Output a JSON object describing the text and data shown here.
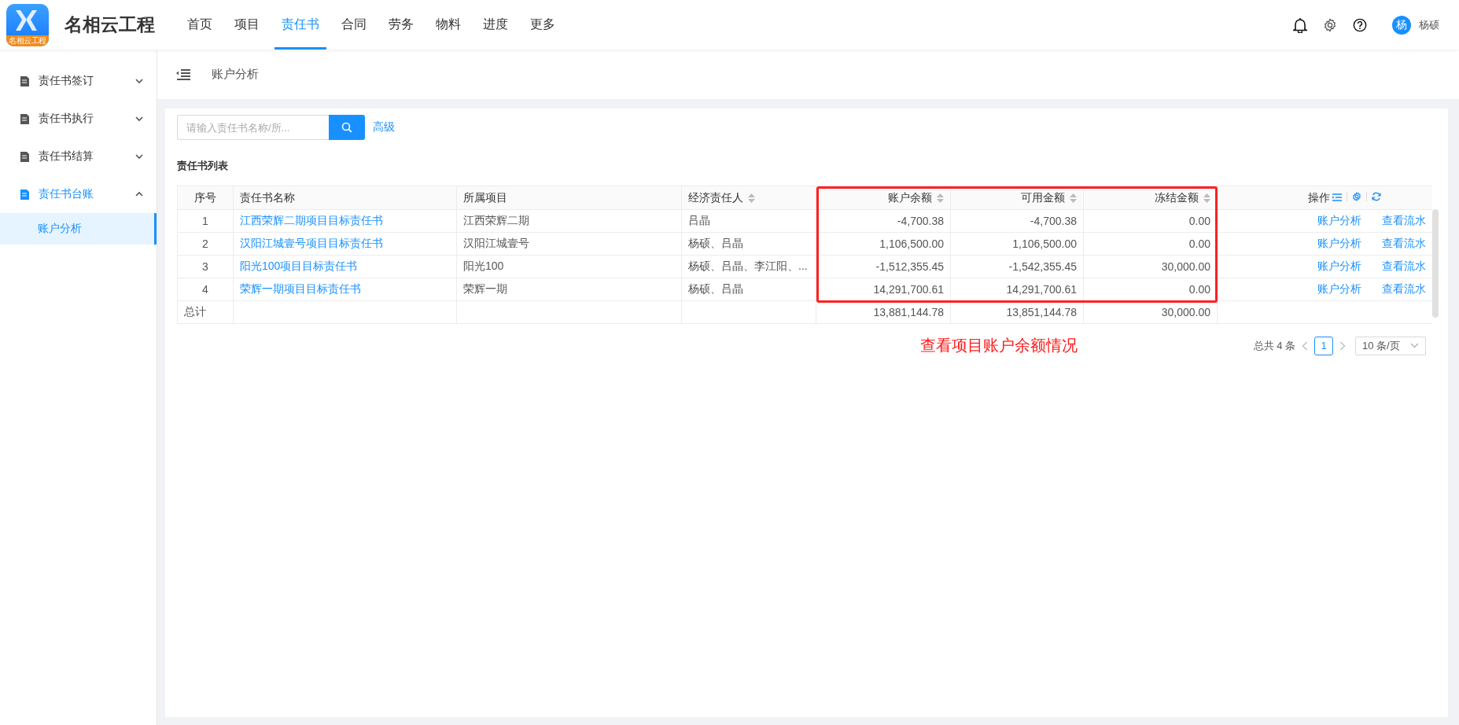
{
  "header": {
    "logo_caption": "名相云工程",
    "app_name": "名相云工程",
    "nav": [
      {
        "label": "首页",
        "selected": false
      },
      {
        "label": "项目",
        "selected": false
      },
      {
        "label": "责任书",
        "selected": true
      },
      {
        "label": "合同",
        "selected": false
      },
      {
        "label": "劳务",
        "selected": false
      },
      {
        "label": "物料",
        "selected": false
      },
      {
        "label": "进度",
        "selected": false
      },
      {
        "label": "更多",
        "selected": false
      }
    ],
    "user": {
      "avatar_text": "杨",
      "name": "杨硕"
    }
  },
  "sidebar": {
    "items": [
      {
        "label": "责任书签订",
        "expanded": false,
        "selected": false
      },
      {
        "label": "责任书执行",
        "expanded": false,
        "selected": false
      },
      {
        "label": "责任书结算",
        "expanded": false,
        "selected": false
      },
      {
        "label": "责任书台账",
        "expanded": true,
        "selected": true,
        "children": [
          {
            "label": "账户分析",
            "selected": true
          }
        ]
      }
    ]
  },
  "breadcrumb": {
    "title": "账户分析"
  },
  "search": {
    "placeholder": "请输入责任书名称/所...",
    "advanced": "高级"
  },
  "list_title": "责任书列表",
  "table": {
    "columns": [
      {
        "label": "序号",
        "kind": "index",
        "sortable": false,
        "highlighted": false
      },
      {
        "label": "责任书名称",
        "kind": "link",
        "sortable": false,
        "highlighted": false
      },
      {
        "label": "所属项目",
        "kind": "text",
        "sortable": false,
        "highlighted": false
      },
      {
        "label": "经济责任人",
        "kind": "text",
        "sortable": true,
        "highlighted": false
      },
      {
        "label": "账户余额",
        "kind": "amount",
        "sortable": true,
        "highlighted": true
      },
      {
        "label": "可用金额",
        "kind": "amount",
        "sortable": true,
        "highlighted": true
      },
      {
        "label": "冻结金额",
        "kind": "amount",
        "sortable": true,
        "highlighted": true
      },
      {
        "label": "操作",
        "kind": "actions",
        "sortable": false,
        "highlighted": false
      }
    ],
    "rows": [
      {
        "cells": [
          "1",
          "江西荣辉二期项目目标责任书",
          "江西荣辉二期",
          "吕晶",
          "-4,700.38",
          "-4,700.38",
          "0.00"
        ],
        "actions": [
          "账户分析",
          "查看流水"
        ]
      },
      {
        "cells": [
          "2",
          "汉阳江城壹号项目目标责任书",
          "汉阳江城壹号",
          "杨硕、吕晶",
          "1,106,500.00",
          "1,106,500.00",
          "0.00"
        ],
        "actions": [
          "账户分析",
          "查看流水"
        ]
      },
      {
        "cells": [
          "3",
          "阳光100项目目标责任书",
          "阳光100",
          "杨硕、吕晶、李江阳、...",
          "-1,512,355.45",
          "-1,542,355.45",
          "30,000.00"
        ],
        "actions": [
          "账户分析",
          "查看流水"
        ]
      },
      {
        "cells": [
          "4",
          "荣辉一期项目目标责任书",
          "荣辉一期",
          "杨硕、吕晶",
          "14,291,700.61",
          "14,291,700.61",
          "0.00"
        ],
        "actions": [
          "账户分析",
          "查看流水"
        ]
      }
    ],
    "total": {
      "label": "总计",
      "amounts": [
        "13,881,144.78",
        "13,851,144.78",
        "30,000.00"
      ]
    }
  },
  "annotation": "查看项目账户余额情况",
  "pagination": {
    "total": "总共 4 条",
    "pages": [
      {
        "label": "1",
        "selected": true
      }
    ],
    "page_size": "10 条/页"
  }
}
